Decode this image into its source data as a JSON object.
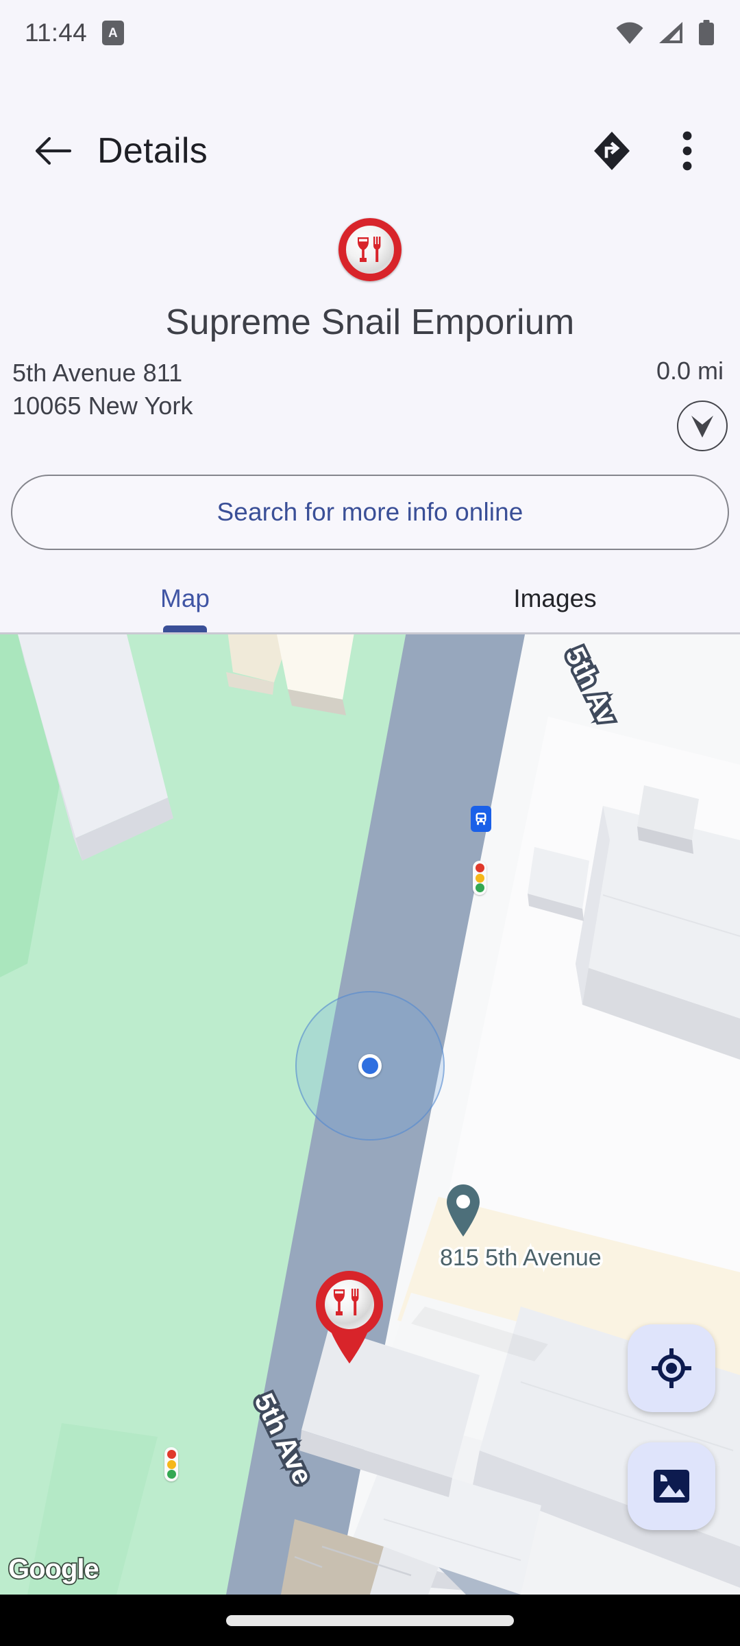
{
  "statusbar": {
    "time": "11:44",
    "notification_badge": "A",
    "icons": [
      "wifi-icon",
      "cellular-signal-icon",
      "battery-icon"
    ]
  },
  "appbar": {
    "back_label": "back-arrow",
    "title": "Details",
    "directions_label": "directions-icon",
    "overflow_label": "more-options-icon"
  },
  "place": {
    "category_icon": "restaurant-icon",
    "name": "Supreme Snail Emporium",
    "address_line1": "5th Avenue 811",
    "address_line2": "10065 New York",
    "distance": "0.0 mi",
    "compass_icon": "compass-arrow-icon"
  },
  "search": {
    "label": "Search for more info online"
  },
  "tabs": [
    {
      "label": "Map",
      "active": true
    },
    {
      "label": "Images",
      "active": false
    }
  ],
  "map": {
    "attribution": "Google",
    "street_label_top": "5th Av",
    "street_label_mid": "5th Ave",
    "poi_label": "815 5th Avenue",
    "fabs": [
      {
        "name": "my-location-button",
        "icon": "crosshair-icon"
      },
      {
        "name": "map-layers-button",
        "icon": "image-layer-icon"
      }
    ],
    "markers": [
      {
        "name": "user-location-dot",
        "type": "location-dot"
      },
      {
        "name": "address-pin",
        "type": "pin",
        "label": "815 5th Avenue"
      },
      {
        "name": "restaurant-pin",
        "type": "poi-pin"
      },
      {
        "name": "transit-stop-icon",
        "type": "transit"
      },
      {
        "name": "traffic-light-icon-upper",
        "type": "traffic-light"
      },
      {
        "name": "traffic-light-icon-lower",
        "type": "traffic-light"
      }
    ]
  },
  "colors": {
    "background": "#f6f5fb",
    "accent_blue": "#3a4f97",
    "park_green": "#bdeccd",
    "road_gray": "#97a7bd",
    "marker_red": "#d8242a",
    "pin_teal": "#4d6f7a",
    "fab_bg": "#dfe4fb",
    "fab_icon": "#0d1b4f",
    "navbar": "#000000"
  },
  "navbar": {
    "gesture_pill": "home-gesture-pill"
  }
}
